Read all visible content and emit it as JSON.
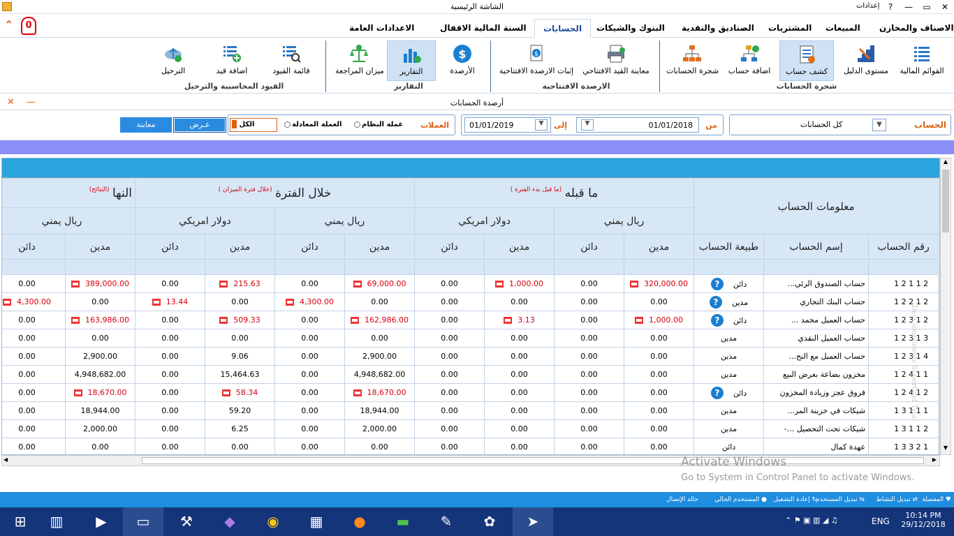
{
  "window": {
    "title": "الشاشة الرئيسية",
    "settings": "إعدادات",
    "help": "?",
    "min": "—",
    "max": "▭",
    "close": "✕"
  },
  "menu": {
    "notif_count": "0",
    "tabs": [
      "الاصناف والمخازن",
      "المبيعات",
      "المشتريات",
      "الصناديق والنقدية",
      "البنوك والشيكات",
      "الحسابات",
      "السنة المالية الاقفال",
      "الاعدادات العامة"
    ],
    "active": "الحسابات"
  },
  "ribbon": {
    "g1": {
      "label": "شجرة الحسابات",
      "items": [
        "القوائم المالية",
        "مستوى الدليل",
        "كشف حساب",
        "اضافة حساب",
        "شجرة الحسابات"
      ]
    },
    "g2": {
      "label": "الارصدة الافتتاحية",
      "items": [
        "معاينة القيد الافتتاحي",
        "إثبات الارصدة الافتتاحية"
      ]
    },
    "g3": {
      "label": "التقارير",
      "items": [
        "الأرصدة",
        "التقارير",
        "ميزان المراجعة"
      ]
    },
    "g4": {
      "label": "القيود المحاسبية والترحيل",
      "items": [
        "قائمة القيود",
        "اضافة قيد",
        "الترحيل"
      ]
    }
  },
  "doc": {
    "title": "أرصدة الحسابات",
    "close": "✕",
    "min": "—"
  },
  "filters": {
    "account_label": "الحساب",
    "account_value": "كل الحسابات",
    "from_label": "من",
    "from_date": "01/01/2018",
    "to_label": "إلى",
    "to_date": "01/01/2019",
    "currencies_label": "العملات",
    "opt_system": "عملة النظام",
    "opt_equiv": "العملة المعادلة",
    "opt_all": "الكل",
    "show_btn": "عـرض",
    "preview_btn": "معاينة"
  },
  "grid": {
    "account_info": "معلومات الحساب",
    "before": "ما قبله",
    "before_note": "(ما قبل بدء الفترة )",
    "during": "خلال الفترة",
    "during_note": "(خلال فترة الميزان )",
    "end": "النها",
    "end_note": "(النتائج)",
    "yer": "ريال يمني",
    "usd": "دولار امريكي",
    "acc_no": "رقم الحساب",
    "acc_name": "إسم الحساب",
    "acc_nature": "طبيعة الحساب",
    "debit": "مدين",
    "credit": "دائن",
    "rows": [
      {
        "no": "1 2 1 1 2",
        "name": "...حساب الصندوق الرئي",
        "nature": "دائن",
        "q": true,
        "v": [
          "320,000.00",
          "0.00",
          "1,000.00",
          "0.00",
          "69,000.00",
          "0.00",
          "215.63",
          "0.00",
          "389,000.00",
          "0.00"
        ],
        "r": [
          1,
          0,
          1,
          0,
          1,
          0,
          1,
          0,
          1,
          0
        ]
      },
      {
        "no": "1 2 2 1 2",
        "name": "حساب البنك التجاري",
        "nature": "مدين",
        "q": true,
        "v": [
          "0.00",
          "0.00",
          "0.00",
          "0.00",
          "0.00",
          "4,300.00",
          "0.00",
          "13.44",
          "0.00",
          "4,300.00"
        ],
        "r": [
          0,
          0,
          0,
          0,
          0,
          1,
          0,
          1,
          0,
          1
        ]
      },
      {
        "no": "1 2 3 1 2",
        "name": "... حساب العميل محمد",
        "nature": "دائن",
        "q": true,
        "v": [
          "1,000.00",
          "0.00",
          "3.13",
          "0.00",
          "162,986.00",
          "0.00",
          "509.33",
          "0.00",
          "163,986.00",
          "0.00"
        ],
        "r": [
          1,
          0,
          1,
          0,
          1,
          0,
          1,
          0,
          1,
          0
        ]
      },
      {
        "no": "1 2 3 1 3",
        "name": "حساب العميل النقدي",
        "nature": "مدين",
        "q": false,
        "v": [
          "0.00",
          "0.00",
          "0.00",
          "0.00",
          "0.00",
          "0.00",
          "0.00",
          "0.00",
          "0.00",
          "0.00"
        ],
        "r": [
          0,
          0,
          0,
          0,
          0,
          0,
          0,
          0,
          0,
          0
        ]
      },
      {
        "no": "1 2 3 1 4",
        "name": "...حساب العميل مع النح",
        "nature": "مدين",
        "q": false,
        "v": [
          "0.00",
          "0.00",
          "0.00",
          "0.00",
          "2,900.00",
          "0.00",
          "9.06",
          "0.00",
          "2,900.00",
          "0.00"
        ],
        "r": [
          0,
          0,
          0,
          0,
          0,
          0,
          0,
          0,
          0,
          0
        ]
      },
      {
        "no": "1 2 4 1 1",
        "name": "مخزون بضاعة بغرض البيع",
        "nature": "مدين",
        "q": false,
        "v": [
          "0.00",
          "0.00",
          "0.00",
          "0.00",
          "4,948,682.00",
          "0.00",
          "15,464.63",
          "0.00",
          "4,948,682.00",
          "0.00"
        ],
        "r": [
          0,
          0,
          0,
          0,
          0,
          0,
          0,
          0,
          0,
          0
        ]
      },
      {
        "no": "1 2 4 1 2",
        "name": "فروق عجز وزيادة المخزون",
        "nature": "دائن",
        "q": true,
        "v": [
          "0.00",
          "0.00",
          "0.00",
          "0.00",
          "18,670.00",
          "0.00",
          "58.34",
          "0.00",
          "18,670.00",
          "0.00"
        ],
        "r": [
          0,
          0,
          0,
          0,
          1,
          0,
          1,
          0,
          1,
          0
        ]
      },
      {
        "no": "1 3 1 1 1",
        "name": "...شيكات في خزينة المر",
        "nature": "مدين",
        "q": false,
        "v": [
          "0.00",
          "0.00",
          "0.00",
          "0.00",
          "18,944.00",
          "0.00",
          "59.20",
          "0.00",
          "18,944.00",
          "0.00"
        ],
        "r": [
          0,
          0,
          0,
          0,
          0,
          0,
          0,
          0,
          0,
          0
        ]
      },
      {
        "no": "1 3 1 1 2",
        "name": "-... شيكات تحت التحصيل",
        "nature": "مدين",
        "q": false,
        "v": [
          "0.00",
          "0.00",
          "0.00",
          "0.00",
          "2,000.00",
          "0.00",
          "6.25",
          "0.00",
          "2,000.00",
          "0.00"
        ],
        "r": [
          0,
          0,
          0,
          0,
          0,
          0,
          0,
          0,
          0,
          0
        ]
      },
      {
        "no": "1 3 3 2 1",
        "name": "عهدة كمال",
        "nature": "دائن",
        "q": false,
        "v": [
          "0.00",
          "0.00",
          "0.00",
          "0.00",
          "0.00",
          "0.00",
          "0.00",
          "0.00",
          "0.00",
          "0.00"
        ],
        "r": [
          0,
          0,
          0,
          0,
          0,
          0,
          0,
          0,
          0,
          0
        ]
      }
    ],
    "watermark": "DevComponents SuperGrid Trial"
  },
  "activate": {
    "line1": "Activate Windows",
    "line2": "Go to System in Control Panel to activate Windows."
  },
  "status": {
    "fav": "المفضلة",
    "switch": "تبديل النشاط",
    "user": "تبديل المستخدم",
    "restart": "إعادة التشغيل",
    "current": "المستخدم الحالي",
    "conn": "حالة الإتصال"
  },
  "taskbar": {
    "lang": "ENG",
    "time": "10:14 PM",
    "date": "29/12/2018"
  },
  "colors": {
    "accent": "#1f8de0",
    "red": "#d8000c",
    "header": "#d7e7f6",
    "band": "#8a8ff7"
  }
}
